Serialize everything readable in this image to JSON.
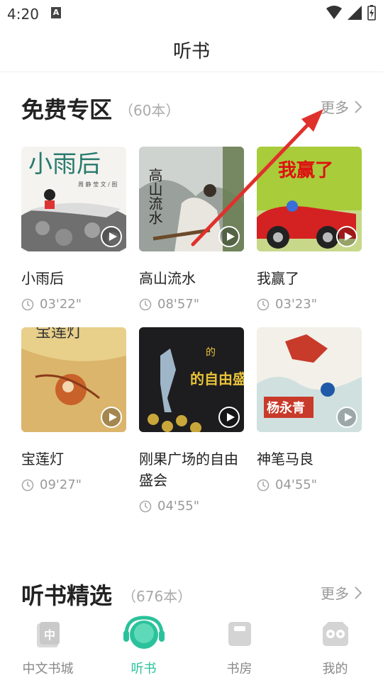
{
  "status": {
    "time": "4:20",
    "a_label": "A"
  },
  "header": {
    "title": "听书"
  },
  "free_section": {
    "title": "免费专区",
    "count": "（60本）",
    "more": "更多",
    "books": [
      {
        "title": "小雨后",
        "duration": "03'22\"",
        "cover_text": "小雨后",
        "cover_sub": "周 静 莹  文 / 图"
      },
      {
        "title": "高山流水",
        "duration": "08'57\"",
        "cover_text": "高山流水"
      },
      {
        "title": "我赢了",
        "duration": "03'23\"",
        "cover_text": "我赢了"
      },
      {
        "title": "宝莲灯",
        "duration": "09'27\"",
        "cover_text": "宝莲灯"
      },
      {
        "title": "刚果广场的自由盛会",
        "duration": "04'55\"",
        "cover_text": "的自由盛会"
      },
      {
        "title": "神笔马良",
        "duration": "04'55\"",
        "cover_text": "杨永青"
      }
    ]
  },
  "picks_section": {
    "title": "听书精选",
    "count": "（676本）",
    "more": "更多"
  },
  "tabs": [
    {
      "label": "中文书城",
      "active": false,
      "icon": "bookstore-icon"
    },
    {
      "label": "听书",
      "active": true,
      "icon": "headphones-icon"
    },
    {
      "label": "书房",
      "active": false,
      "icon": "bookshelf-icon"
    },
    {
      "label": "我的",
      "active": false,
      "icon": "profile-icon"
    }
  ],
  "colors": {
    "accent": "#2bc29b",
    "annotation_arrow": "#e0302c"
  }
}
